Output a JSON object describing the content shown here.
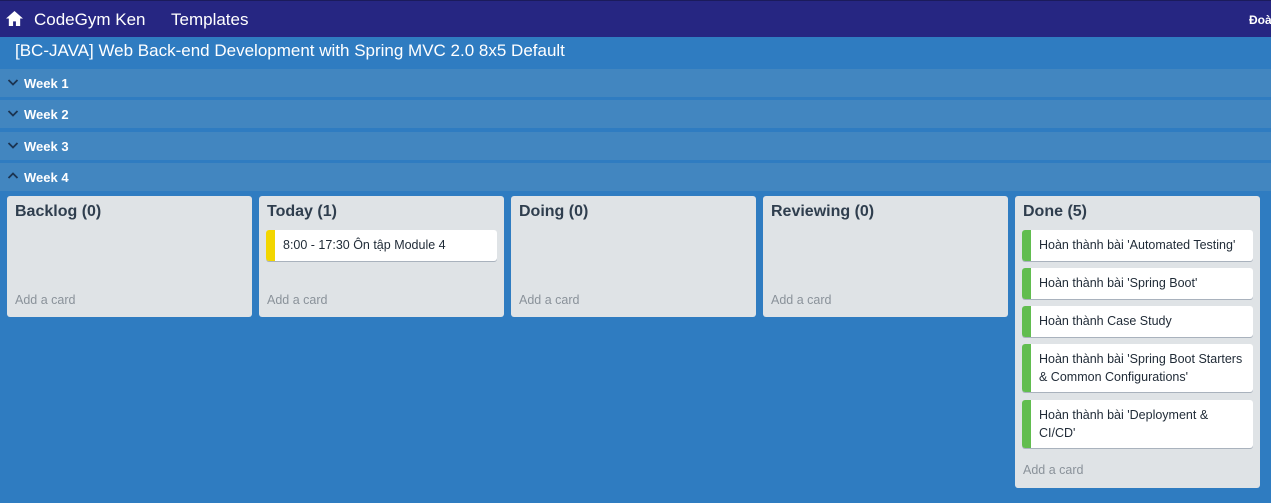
{
  "nav": {
    "home_icon": "home-icon",
    "brand": "CodeGym Ken",
    "templates": "Templates",
    "user": "Đoàn"
  },
  "board": {
    "title": "[BC-JAVA] Web Back-end Development with Spring MVC 2.0 8x5 Default"
  },
  "weeks": [
    {
      "label": "Week 1",
      "icon": "chevron-down-icon"
    },
    {
      "label": "Week 2",
      "icon": "chevron-down-icon"
    },
    {
      "label": "Week 3",
      "icon": "chevron-down-icon"
    },
    {
      "label": "Week 4",
      "icon": "chevron-up-icon"
    }
  ],
  "lists": [
    {
      "title": "Backlog (0)",
      "add_card": "Add a card",
      "cards": []
    },
    {
      "title": "Today (1)",
      "add_card": "Add a card",
      "cards": [
        {
          "text": "8:00 - 17:30 Ôn tập Module 4",
          "label_color": "#f2d600"
        }
      ]
    },
    {
      "title": "Doing (0)",
      "add_card": "Add a card",
      "cards": []
    },
    {
      "title": "Reviewing (0)",
      "add_card": "Add a card",
      "cards": []
    },
    {
      "title": "Done (5)",
      "add_card": "Add a card",
      "cards": [
        {
          "text": "Hoàn thành bài 'Automated Testing'",
          "label_color": "#61bd4f"
        },
        {
          "text": "Hoàn thành bài 'Spring Boot'",
          "label_color": "#61bd4f"
        },
        {
          "text": "Hoàn thành Case Study",
          "label_color": "#61bd4f"
        },
        {
          "text": "Hoàn thành bài 'Spring Boot Starters & Common Configurations'",
          "label_color": "#61bd4f"
        },
        {
          "text": "Hoàn thành bài 'Deployment & CI/CD'",
          "label_color": "#61bd4f"
        }
      ]
    }
  ],
  "colors": {
    "nav_bg": "#262682",
    "board_bg": "#2f7cc1",
    "week_bar": "#4286c0",
    "list_bg": "#dfe3e6"
  }
}
